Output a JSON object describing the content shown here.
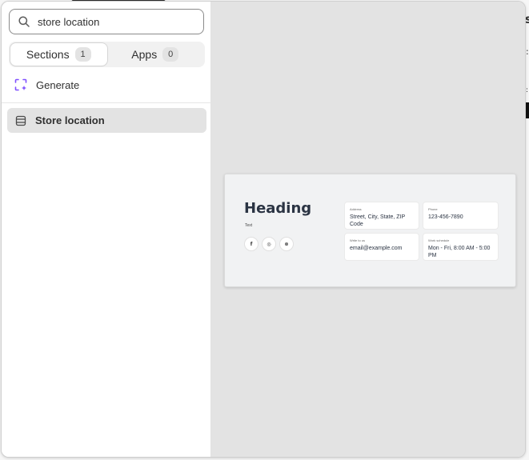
{
  "search": {
    "value": "store location"
  },
  "tabs": [
    {
      "label": "Sections",
      "count": "1",
      "active": true
    },
    {
      "label": "Apps",
      "count": "0",
      "active": false
    }
  ],
  "generate": {
    "label": "Generate",
    "icon": "sparkle-frame-icon",
    "accent": "#8051ff"
  },
  "results": [
    {
      "label": "Store location",
      "icon": "section-layout-icon",
      "selected": true
    }
  ],
  "preview": {
    "heading": "Heading",
    "subtext": "Text",
    "social_icons": [
      "facebook-icon",
      "instagram-icon",
      "pinterest-icon"
    ],
    "social_glyphs": [
      "f",
      "◎",
      "⊗"
    ],
    "info": {
      "address_label": "Address",
      "address_value": "Street, City, State, ZIP Code",
      "phone_label": "Phone",
      "phone_value": "123-456-7890",
      "email_label": "Write to us",
      "email_value": "email@example.com",
      "hours_label": "Work schedule",
      "hours_value": "Mon - Fri, 8:00 AM - 5:00 PM"
    }
  }
}
